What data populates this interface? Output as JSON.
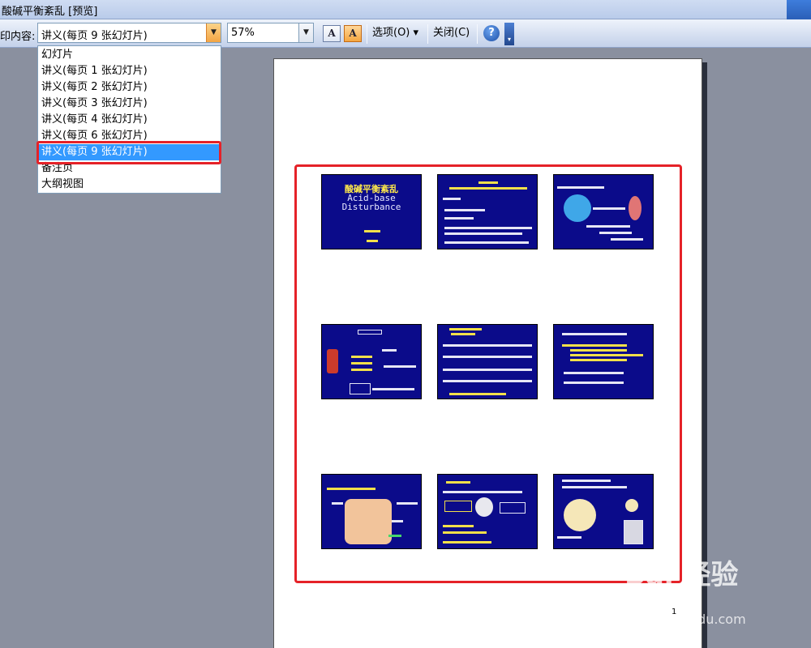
{
  "window": {
    "title": "酸碱平衡紊乱 [预览]"
  },
  "toolbar": {
    "print_content_label": "印内容:",
    "print_content_value": "讲义(每页 9 张幻灯片)",
    "zoom_value": "57%",
    "options_label": "选项(O) ▾",
    "close_label": "关闭(C)",
    "help_glyph": "?"
  },
  "dropdown": {
    "items": [
      "幻灯片",
      "讲义(每页 1 张幻灯片)",
      "讲义(每页 2 张幻灯片)",
      "讲义(每页 3 张幻灯片)",
      "讲义(每页 4 张幻灯片)",
      "讲义(每页 6 张幻灯片)",
      "讲义(每页 9 张幻灯片)",
      "备注页",
      "大纲视图"
    ],
    "selected_index": 6
  },
  "preview": {
    "page_number": "1",
    "first_slide": {
      "title": "酸碱平衡紊乱",
      "subtitle_line1": "Acid-base",
      "subtitle_line2": "Disturbance"
    }
  },
  "watermark": {
    "text": "Bai 经验",
    "url": "jingyan.baidu.com"
  },
  "colors": {
    "slide_bg": "#0b0b8a",
    "highlight": "#e52228",
    "selected": "#3399ff"
  }
}
